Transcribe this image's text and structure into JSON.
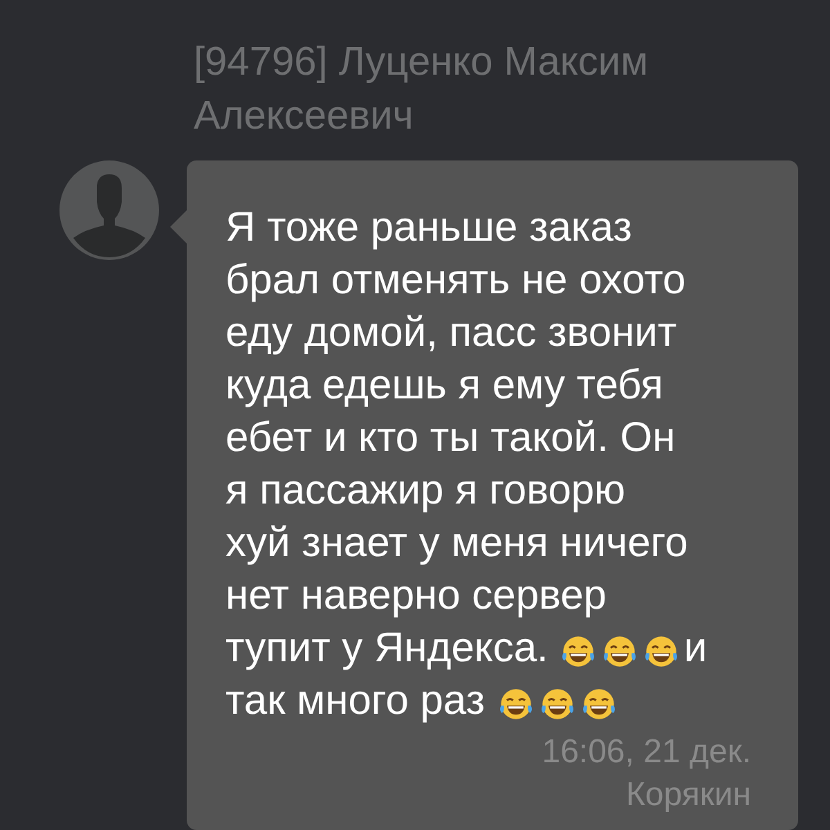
{
  "chat": {
    "sender": "[94796] Луценко Максим Алексеевич"
  },
  "message": {
    "lines": [
      {
        "segments": [
          {
            "kind": "text",
            "text": "Я тоже раньше заказ"
          }
        ]
      },
      {
        "segments": [
          {
            "kind": "text",
            "text": "брал отменять не охото"
          }
        ]
      },
      {
        "segments": [
          {
            "kind": "text",
            "text": "еду домой, пасс звонит"
          }
        ]
      },
      {
        "segments": [
          {
            "kind": "text",
            "text": "куда едешь я ему тебя"
          }
        ]
      },
      {
        "segments": [
          {
            "kind": "text",
            "text": "ебет и кто ты такой. Он"
          }
        ]
      },
      {
        "segments": [
          {
            "kind": "text",
            "text": "я пассажир я говорю"
          }
        ]
      },
      {
        "segments": [
          {
            "kind": "text",
            "text": "хуй знает у меня ничего"
          }
        ]
      },
      {
        "segments": [
          {
            "kind": "text",
            "text": "нет наверно сервер"
          }
        ]
      },
      {
        "segments": [
          {
            "kind": "text",
            "text": "тупит у Яндекса."
          },
          {
            "kind": "emoji"
          },
          {
            "kind": "emoji"
          },
          {
            "kind": "emoji"
          },
          {
            "kind": "text",
            "text": "и"
          }
        ]
      },
      {
        "segments": [
          {
            "kind": "text",
            "text": "так много раз"
          },
          {
            "kind": "emoji"
          },
          {
            "kind": "emoji"
          },
          {
            "kind": "emoji"
          }
        ]
      }
    ],
    "time": "16:06, 21 дек.",
    "author": "Корякин"
  }
}
